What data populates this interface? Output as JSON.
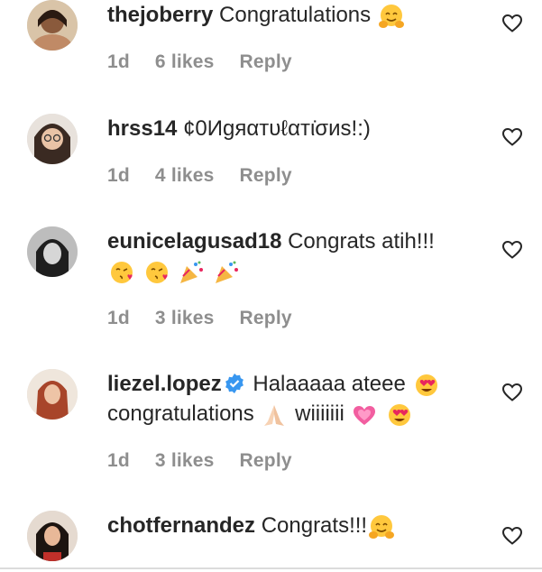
{
  "comments": [
    {
      "username": "thejoberry",
      "text": "Congratulations",
      "emoji_after": [
        "hug-emoji"
      ],
      "time": "1d",
      "likes": "6 likes",
      "reply": "Reply"
    },
    {
      "username": "hrss14",
      "text": "¢0Иgяαтυℓαтι̇σиs!:)",
      "time": "1d",
      "likes": "4 likes",
      "reply": "Reply"
    },
    {
      "username": "eunicelagusad18",
      "text": "Congrats atih!!!",
      "line2_emoji": [
        "kiss-emoji",
        "kiss-emoji",
        "party-popper-emoji",
        "party-popper-emoji"
      ],
      "time": "1d",
      "likes": "3 likes",
      "reply": "Reply"
    },
    {
      "username": "liezel.lopez",
      "verified": true,
      "text": "Halaaaaa ateee",
      "line2_a": "congratulations",
      "line2_b": "wiiiiiii",
      "time": "1d",
      "likes": "3 likes",
      "reply": "Reply"
    },
    {
      "username": "chotfernandez",
      "text": "Congrats!!!",
      "emoji_after": [
        "hug-emoji"
      ]
    }
  ],
  "colors": {
    "text": "#262626",
    "meta": "#8e8e8e",
    "verified": "#3897f0",
    "heart_outline": "#262626"
  }
}
